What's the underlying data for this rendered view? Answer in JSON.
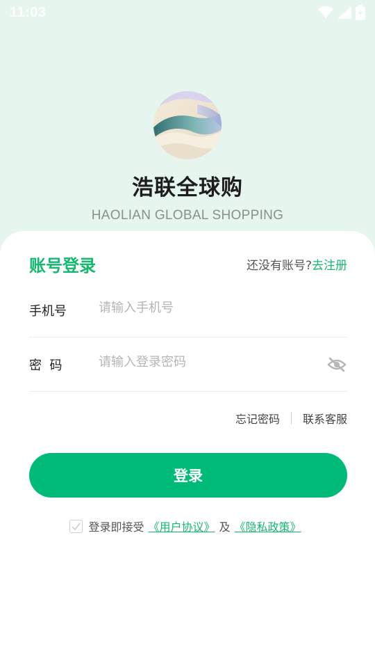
{
  "status_bar": {
    "time": "11:03",
    "icons": [
      "wifi-icon",
      "signal-icon",
      "battery-charging-icon"
    ]
  },
  "brand": {
    "name": "浩联全球购",
    "subtitle": "HAOLIAN GLOBAL  SHOPPING",
    "logo": "gradient-sphere-logo"
  },
  "login": {
    "title": "账号登录",
    "register_prompt": "还没有账号?",
    "register_link": "去注册",
    "phone": {
      "label": "手机号",
      "placeholder": "请输入手机号",
      "value": ""
    },
    "password": {
      "label": "密  码",
      "placeholder": "请输入登录密码",
      "value": "",
      "toggle_icon": "eye-off-icon"
    },
    "forgot_password": "忘记密码",
    "contact_support": "联系客服",
    "submit_label": "登录"
  },
  "agreement": {
    "prefix": "登录即接受",
    "user_agreement": "《用户协议》",
    "conjunction": "及",
    "privacy_policy": "《隐私政策》",
    "checked": false
  },
  "colors": {
    "accent": "#00bb77",
    "accent_text": "#14b86f",
    "background": "#e6f5ee"
  }
}
